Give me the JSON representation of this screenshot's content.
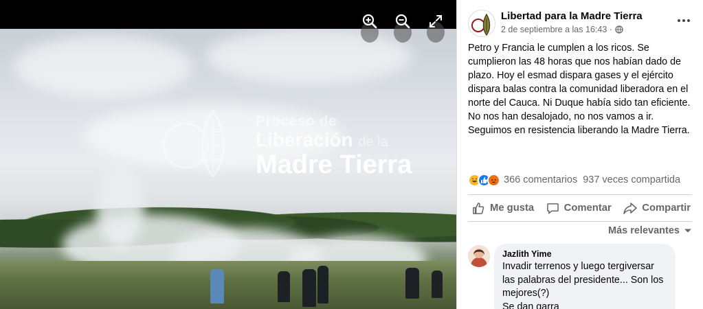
{
  "viewer": {
    "zoom_in_label": "Zoom in",
    "zoom_out_label": "Zoom out",
    "fullscreen_label": "Fullscreen",
    "watermark": {
      "line1": "Proceso de",
      "line2_main": "Liberación",
      "line2_small": "de la",
      "line3": "Madre Tierra"
    }
  },
  "post": {
    "page_name": "Libertad para la Madre Tierra",
    "timestamp": "2 de septiembre a las 16:43 ·",
    "text": "Petro y Francia le cumplen a los ricos. Se cumplieron las 48 horas que nos habían dado de plazo. Hoy el esmad dispara gases y el ejército dispara balas contra la comunidad liberadora en el norte del Cauca. Ni Duque había sido tan eficiente. No nos han desalojado, no nos vamos a ir. Seguimos en resistencia liberando la Madre Tierra.",
    "comments_count": "366 comentarios",
    "shares_count": "937 veces compartida",
    "reactions": [
      "haha",
      "like",
      "angry"
    ]
  },
  "actions": {
    "like": "Me gusta",
    "comment": "Comentar",
    "share": "Compartir"
  },
  "sort_label": "Más relevantes",
  "comments": [
    {
      "author": "Jazlith Yime",
      "text": "Invadir terrenos y luego tergiversar las palabras del presidente... Son los mejores(?)\nSe dan garra"
    }
  ],
  "colors": {
    "secondary_text": "#65676b",
    "bubble_bg": "#f0f2f5",
    "like_blue": "#1877f2",
    "haha_yellow": "#f7b928",
    "angry_orange": "#e9710f"
  }
}
